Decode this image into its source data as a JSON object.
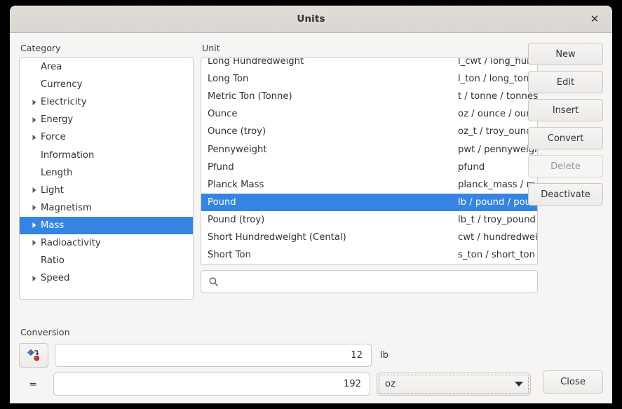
{
  "window": {
    "title": "Units",
    "close_icon": "close-icon",
    "close_glyph": "✕"
  },
  "accent_color": "#3584e4",
  "category": {
    "label": "Category",
    "items": [
      {
        "label": "Area",
        "expander": false,
        "selected": false
      },
      {
        "label": "Currency",
        "expander": false,
        "selected": false
      },
      {
        "label": "Electricity",
        "expander": true,
        "selected": false
      },
      {
        "label": "Energy",
        "expander": true,
        "selected": false
      },
      {
        "label": "Force",
        "expander": true,
        "selected": false
      },
      {
        "label": "Information",
        "expander": false,
        "selected": false
      },
      {
        "label": "Length",
        "expander": false,
        "selected": false
      },
      {
        "label": "Light",
        "expander": true,
        "selected": false
      },
      {
        "label": "Magnetism",
        "expander": true,
        "selected": false
      },
      {
        "label": "Mass",
        "expander": true,
        "selected": true
      },
      {
        "label": "Radioactivity",
        "expander": true,
        "selected": false
      },
      {
        "label": "Ratio",
        "expander": false,
        "selected": false
      },
      {
        "label": "Speed",
        "expander": true,
        "selected": false
      }
    ]
  },
  "unit": {
    "label": "Unit",
    "rows": [
      {
        "name": "Long Hundredweight",
        "alias": "l_cwt / long_hund",
        "selected": false
      },
      {
        "name": "Long Ton",
        "alias": "l_ton / long_ton / l",
        "selected": false
      },
      {
        "name": "Metric Ton (Tonne)",
        "alias": "t / tonne / tonnes /",
        "selected": false
      },
      {
        "name": "Ounce",
        "alias": "oz / ounce / ounce",
        "selected": false
      },
      {
        "name": "Ounce (troy)",
        "alias": "oz_t / troy_ounce",
        "selected": false
      },
      {
        "name": "Pennyweight",
        "alias": "pwt / pennyweight",
        "selected": false
      },
      {
        "name": "Pfund",
        "alias": "pfund",
        "selected": false
      },
      {
        "name": "Planck Mass",
        "alias": "planck_mass / m_",
        "selected": false
      },
      {
        "name": "Pound",
        "alias": "lb / pound / pounds",
        "selected": true
      },
      {
        "name": "Pound (troy)",
        "alias": "lb_t / troy_pound ,",
        "selected": false
      },
      {
        "name": "Short Hundredweight (Cental)",
        "alias": "cwt / hundredweig",
        "selected": false
      },
      {
        "name": "Short Ton",
        "alias": "s_ton / short_ton ,",
        "selected": false
      }
    ],
    "search": {
      "icon": "search-icon",
      "value": "",
      "placeholder": ""
    }
  },
  "buttons": {
    "new": "New",
    "edit": "Edit",
    "insert": "Insert",
    "convert": "Convert",
    "delete": "Delete",
    "deactivate": "Deactivate"
  },
  "conversion": {
    "label": "Conversion",
    "swap_icon": "convert-swap-icon",
    "from_value": "12",
    "from_unit": "lb",
    "equals_label": "=",
    "to_value": "192",
    "to_unit": "oz"
  },
  "footer": {
    "close": "Close"
  }
}
